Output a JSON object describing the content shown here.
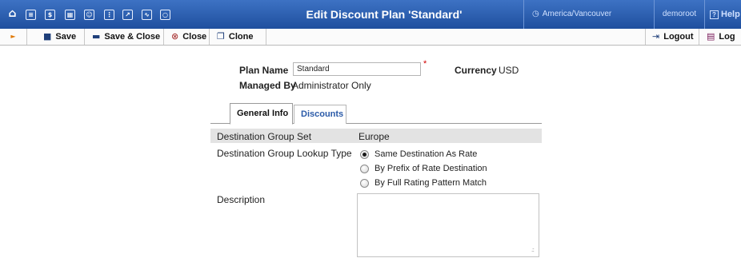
{
  "header": {
    "title": "Edit Discount Plan 'Standard'",
    "timezone": "America/Vancouver",
    "user": "demoroot",
    "help_label": "Help",
    "nav_icons": [
      "home-icon",
      "list-icon",
      "dollar-icon",
      "grid-icon",
      "person-icon",
      "network-icon",
      "export-icon",
      "chart-icon",
      "search-icon"
    ]
  },
  "toolbar": {
    "save_label": "Save",
    "save_close_label": "Save & Close",
    "close_label": "Close",
    "clone_label": "Clone",
    "logout_label": "Logout",
    "log_label": "Log"
  },
  "form": {
    "plan_name_label": "Plan Name",
    "plan_name_value": "Standard",
    "required_mark": "*",
    "currency_label": "Currency",
    "currency_value": "USD",
    "managed_by_label": "Managed By",
    "managed_by_value": "Administrator Only"
  },
  "tabs": [
    {
      "label": "General Info",
      "active": true
    },
    {
      "label": "Discounts",
      "active": false
    }
  ],
  "general_info": {
    "dest_group_set_label": "Destination Group Set",
    "dest_group_set_value": "Europe",
    "lookup_type_label": "Destination Group Lookup Type",
    "lookup_options": [
      {
        "label": "Same Destination As Rate",
        "checked": true
      },
      {
        "label": "By Prefix of Rate Destination",
        "checked": false
      },
      {
        "label": "By Full Rating Pattern Match",
        "checked": false
      }
    ],
    "description_label": "Description",
    "description_value": ""
  },
  "colors": {
    "header_bg": "#2a5db0",
    "link": "#2a5aa8",
    "required": "#d00000",
    "row_shade": "#e3e3e3"
  }
}
